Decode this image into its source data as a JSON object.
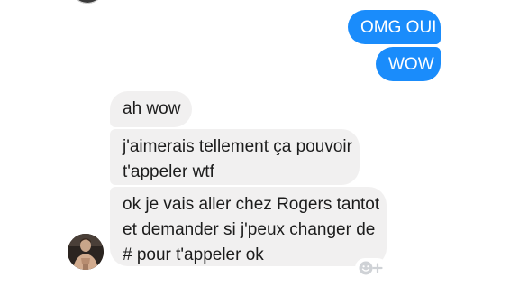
{
  "conversation": {
    "sent_messages": [
      {
        "text": "OMG OUI"
      },
      {
        "text": "WOW"
      }
    ],
    "received_messages": [
      {
        "lines": [
          "ah wow"
        ]
      },
      {
        "lines": [
          "j'aimerais tellement ça pouvoir",
          "t'appeler wtf"
        ]
      },
      {
        "lines": [
          "ok je vais aller chez Rogers tantot",
          "et demander si j'peux changer de",
          "# pour t'appeler ok"
        ]
      }
    ]
  },
  "colors": {
    "sent_bubble": "#1a8cfb",
    "received_bubble": "#f1f0f0",
    "received_text": "#1c1c1c"
  },
  "icons": {
    "avatar": "contact-avatar",
    "reaction": "add-reaction-icon"
  }
}
